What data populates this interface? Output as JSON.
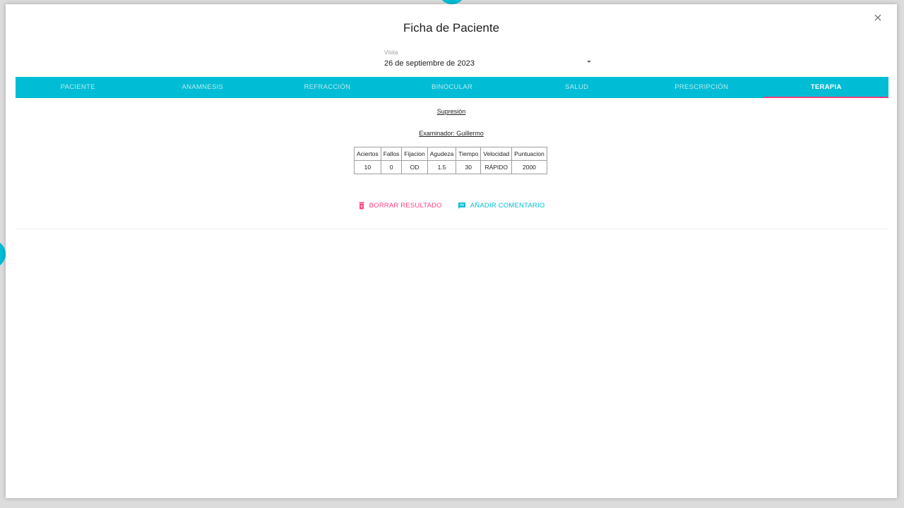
{
  "modal": {
    "title": "Ficha de Paciente",
    "close_icon": "close-icon"
  },
  "visit": {
    "label": "Visita",
    "value": "26 de septiembre de 2023"
  },
  "tabs": [
    {
      "label": "PACIENTE",
      "active": false
    },
    {
      "label": "ANAMNESIS",
      "active": false
    },
    {
      "label": "REFRACCIÓN",
      "active": false
    },
    {
      "label": "BINOCULAR",
      "active": false
    },
    {
      "label": "SALUD",
      "active": false
    },
    {
      "label": "PRESCRIPCIÓN",
      "active": false
    },
    {
      "label": "TERAPIA",
      "active": true
    }
  ],
  "therapy": {
    "section_title": "Supresión",
    "examiner": "Examinador: Guillermo",
    "table": {
      "headers": [
        "Aciertos",
        "Fallos",
        "Fijacion",
        "Agudeza",
        "Tiempo",
        "Velocidad",
        "Puntuacion"
      ],
      "rows": [
        [
          "10",
          "0",
          "OD",
          "1.5",
          "30",
          "RÁPIDO",
          "2000"
        ]
      ]
    }
  },
  "actions": {
    "delete_label": "BORRAR RESULTADO",
    "delete_icon": "trash-icon",
    "comment_label": "AÑADIR COMENTARIO",
    "comment_icon": "comment-icon"
  },
  "colors": {
    "accent": "#00bcd4",
    "danger": "#ff4081"
  }
}
